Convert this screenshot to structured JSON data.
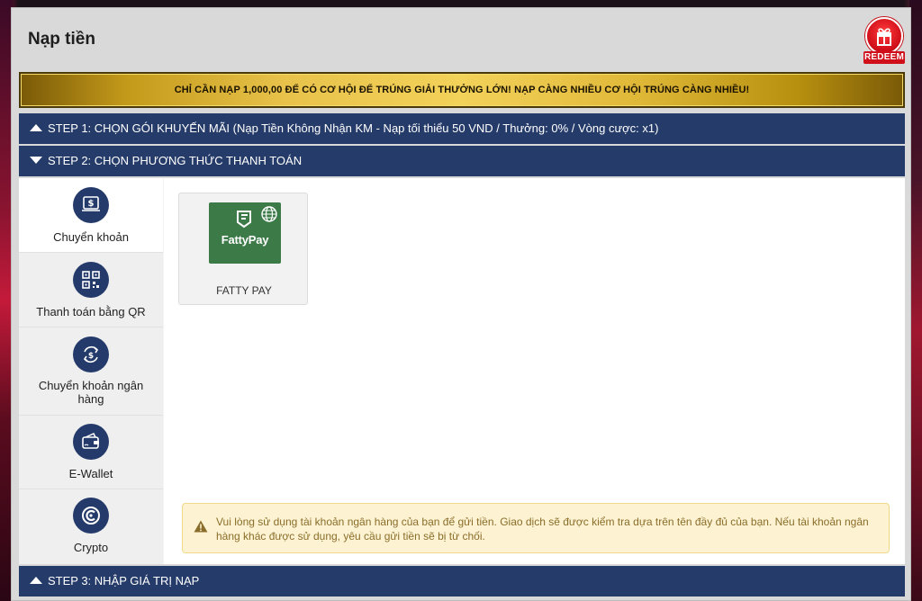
{
  "header": {
    "title": "Nạp tiền",
    "redeem_label": "REDEEM"
  },
  "marquee": {
    "text": "CHỈ CẦN NẠP 1,000,00 ĐỂ CÓ CƠ HỘI ĐỂ TRÚNG GIẢI THƯỞNG LỚN! NẠP CÀNG NHIỀU CƠ HỘI TRÚNG CÀNG NHIỀU!"
  },
  "steps": [
    {
      "label": "STEP 1: CHỌN GÓI KHUYẾN MÃI (Nạp Tiền Không Nhận KM - Nạp tối thiểu 50 VND / Thưởng: 0% / Vòng cược: x1)",
      "state": "collapsed"
    },
    {
      "label": "STEP 2: CHỌN PHƯƠNG THỨC THANH TOÁN",
      "state": "expanded"
    },
    {
      "label": "STEP 3: NHẬP GIÁ TRỊ NẠP",
      "state": "collapsed"
    }
  ],
  "methods": [
    {
      "label": "Chuyển khoản",
      "icon": "transfer-icon",
      "active": true
    },
    {
      "label": "Thanh toán bằng QR",
      "icon": "qr-code-icon",
      "active": false
    },
    {
      "label": "Chuyển khoản ngân hàng",
      "icon": "bank-exchange-icon",
      "active": false
    },
    {
      "label": "E-Wallet",
      "icon": "wallet-icon",
      "active": false
    },
    {
      "label": "Crypto",
      "icon": "crypto-icon",
      "active": false
    }
  ],
  "providers": [
    {
      "name": "FATTY PAY",
      "logo_text": "FattyPay",
      "logo_color": "#3c7a48"
    }
  ],
  "notice": {
    "text": "Vui lòng sử dụng tài khoản ngân hàng của bạn để gửi tiền. Giao dịch sẽ được kiểm tra dựa trên tên đầy đủ của bạn. Nếu tài khoản ngân hàng khác được sử dụng, yêu cầu gửi tiền sẽ bị từ chối."
  },
  "colors": {
    "step_bar": "#253b6a",
    "icon_circle": "#233a6a",
    "notice_bg": "#fdf3d2",
    "notice_text": "#8a6d2a",
    "gold": "#e8c24a"
  }
}
